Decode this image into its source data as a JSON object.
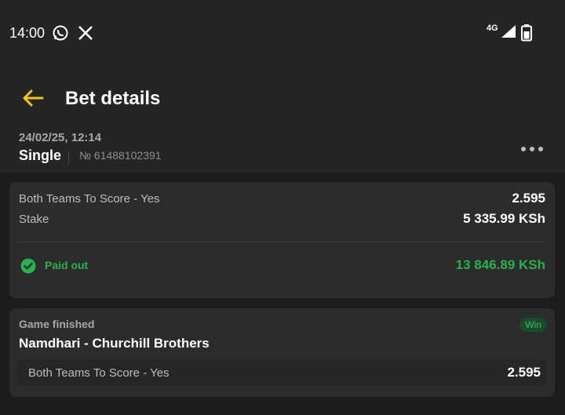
{
  "status_bar": {
    "time": "14:00",
    "network": "4G",
    "icons": [
      "whatsapp-icon",
      "x-icon",
      "signal-icon",
      "battery-icon"
    ]
  },
  "header": {
    "title": "Bet details",
    "date": "24/02/25, 12:14",
    "bet_type": "Single",
    "bet_number": "№ 61488102391"
  },
  "summary": {
    "selection_label": "Both Teams To Score - Yes",
    "odds": "2.595",
    "stake_label": "Stake",
    "stake_value": "5 335.99 KSh",
    "status_label": "Paid out",
    "payout_value": "13 846.89 KSh"
  },
  "event": {
    "status": "Game finished",
    "result_badge": "Win",
    "match": "Namdhari - Churchill Brothers",
    "selection_label": "Both Teams To Score - Yes",
    "odds": "2.595"
  },
  "colors": {
    "background": "#1c1c1c",
    "header": "#252525",
    "card": "#2c2c2c",
    "accent": "#f5c518",
    "success": "#29b04f"
  }
}
